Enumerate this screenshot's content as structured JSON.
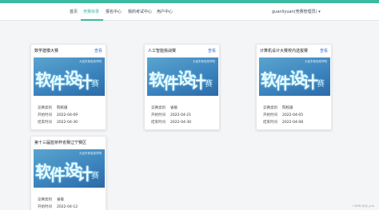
{
  "nav": {
    "items": [
      "首页",
      "竞赛目录",
      "报名中心",
      "我的考试中心",
      "用户中心"
    ],
    "active_index": 1,
    "user_label": "guanliyuan(竞赛管理员) ▾"
  },
  "cards": [
    {
      "title": "数学建模大赛",
      "link": "查看",
      "fields": [
        {
          "k": "竞赛类别",
          "v": "院校级"
        },
        {
          "k": "开始时间",
          "v": "2022-04-09"
        },
        {
          "k": "结束时间",
          "v": "2022-04-30"
        }
      ]
    },
    {
      "title": "人工智能挑战赛",
      "link": "查看",
      "fields": [
        {
          "k": "竞赛类别",
          "v": "省级"
        },
        {
          "k": "开始时间",
          "v": "2022-04-21"
        },
        {
          "k": "结束时间",
          "v": "2022-04-30"
        }
      ]
    },
    {
      "title": "计算机设计大赛校内选拔赛",
      "link": "查看",
      "fields": [
        {
          "k": "竞赛类别",
          "v": "院校级"
        },
        {
          "k": "开始时间",
          "v": "2022-04-05"
        },
        {
          "k": "结束时间",
          "v": "2022-04-08"
        }
      ]
    },
    {
      "title": "第十三届蓝桥杯省赛辽宁赛区",
      "link": "查看",
      "fields": [
        {
          "k": "竞赛类别",
          "v": "省级"
        },
        {
          "k": "开始时间",
          "v": "2022-04-12"
        }
      ]
    }
  ],
  "banner": {
    "logo": "大连东软信息学院",
    "text": "软件设计大赛"
  },
  "watermark": "CSDN @jiji_yun"
}
